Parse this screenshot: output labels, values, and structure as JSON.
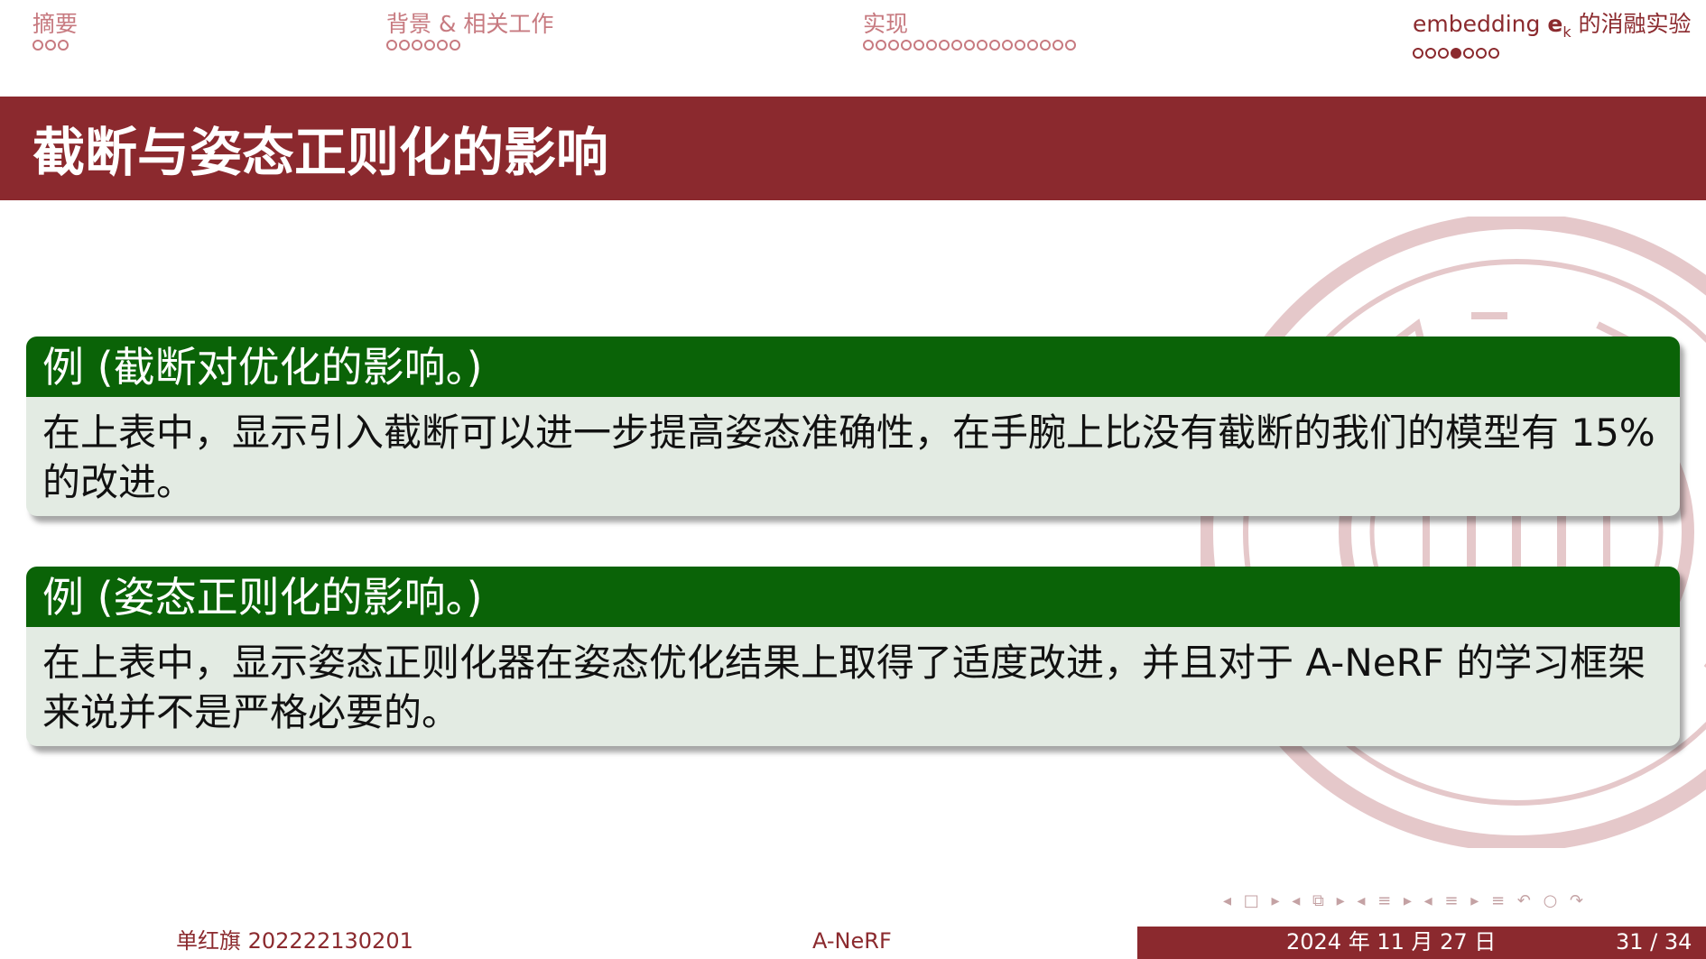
{
  "nav": {
    "sections": [
      {
        "label": "摘要",
        "dots": 3,
        "active_dot": null,
        "current": false
      },
      {
        "label": "背景 & 相关工作",
        "dots": 6,
        "active_dot": null,
        "current": false
      },
      {
        "label": "实现",
        "dots": 17,
        "active_dot": null,
        "current": false
      },
      {
        "label_prefix": "embedding",
        "label_sym": "e",
        "label_sub": "k",
        "label_suffix": "的消融实验",
        "dots": 7,
        "active_dot": 4,
        "current": true
      }
    ]
  },
  "frame": {
    "title": "截断与姿态正则化的影响"
  },
  "examples": [
    {
      "title": "例 (截断对优化的影响。)",
      "body": "在上表中，显示引入截断可以进一步提高姿态准确性，在手腕上比没有截断的我们的模型有 15% 的改进。"
    },
    {
      "title": "例 (姿态正则化的影响。)",
      "body": "在上表中，显示姿态正则化器在姿态优化结果上取得了适度改进，并且对于 A-NeRF 的学习框架来说并不是严格必要的。"
    }
  ],
  "nav_symbols": "◂ □ ▸ ◂ ⧉ ▸ ◂ ≡ ▸ ◂ ≡ ▸   ≡   ↶ ○ ↷",
  "footer": {
    "author": "单红旗 202222130201",
    "short_title": "A-NeRF",
    "date": "2024 年 11 月 27 日",
    "page": "31 / 34"
  },
  "colors": {
    "title_bar": "#8b292e",
    "block_head": "#0a6307",
    "block_body": "#e3ebe3",
    "nav_inactive": "#c77a80"
  }
}
